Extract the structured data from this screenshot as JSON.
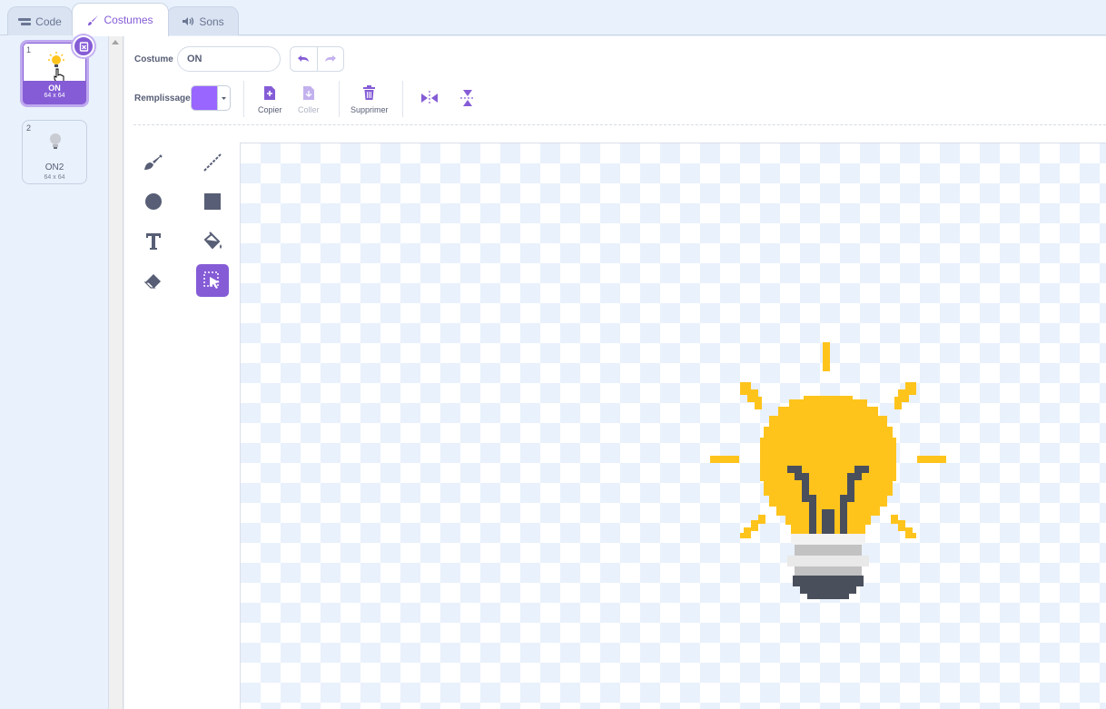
{
  "tabs": {
    "code": "Code",
    "costumes": "Costumes",
    "sounds": "Sons"
  },
  "costumes": [
    {
      "number": "1",
      "name": "ON",
      "size": "64 x 64",
      "selected": true
    },
    {
      "number": "2",
      "name": "ON2",
      "size": "64 x 64",
      "selected": false
    }
  ],
  "editor": {
    "costume_label": "Costume",
    "costume_name": "ON",
    "fill_label": "Remplissage",
    "fill_color": "#9966ff",
    "copy_label": "Copier",
    "paste_label": "Coller",
    "delete_label": "Supprimer"
  },
  "tools": [
    {
      "name": "brush",
      "icon": "brush-icon"
    },
    {
      "name": "line",
      "icon": "line-icon"
    },
    {
      "name": "circle",
      "icon": "circle-icon"
    },
    {
      "name": "rectangle",
      "icon": "rectangle-icon"
    },
    {
      "name": "text",
      "icon": "text-icon"
    },
    {
      "name": "fill",
      "icon": "fill-bucket-icon"
    },
    {
      "name": "eraser",
      "icon": "eraser-icon"
    },
    {
      "name": "select",
      "icon": "select-icon",
      "active": true
    }
  ],
  "colors": {
    "accent": "#855cd6",
    "bulb_yellow": "#ffc41c",
    "bulb_dark": "#4a4f5c"
  }
}
